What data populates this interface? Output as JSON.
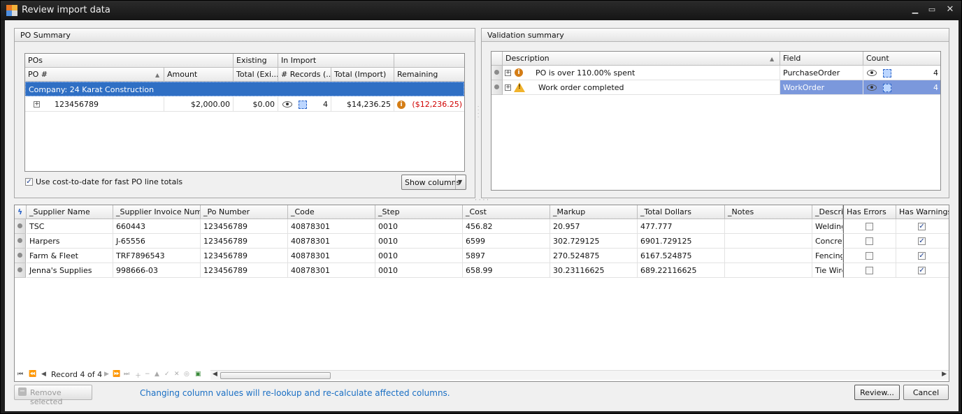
{
  "window": {
    "title": "Review import data"
  },
  "po_summary": {
    "title": "PO Summary",
    "bands": {
      "pos": "POs",
      "existing": "Existing",
      "in_import": "In Import"
    },
    "columns": [
      "PO #",
      "Amount",
      "Total (Exi...",
      "# Records (...",
      "Total (Import)",
      "Remaining"
    ],
    "group_label": "Company: 24 Karat Construction",
    "row": {
      "po": "123456789",
      "amount": "$2,000.00",
      "total_existing": "$0.00",
      "records": "4",
      "total_import": "$14,236.25",
      "remaining": "($12,236.25)"
    },
    "option_label": "Use cost-to-date for fast PO line totals",
    "show_columns_label": "Show columns"
  },
  "validation": {
    "title": "Validation summary",
    "columns": [
      "Description",
      "Field",
      "Count"
    ],
    "rows": [
      {
        "description": "PO is over 110.00% spent",
        "field": "PurchaseOrder",
        "count": "4"
      },
      {
        "description": "Work order completed",
        "field": "WorkOrder",
        "count": "4"
      }
    ]
  },
  "records": {
    "columns": [
      "_Supplier Name",
      "_Supplier Invoice Num...",
      "_Po Number",
      "_Code",
      "_Step",
      "_Cost",
      "_Markup",
      "_Total Dollars",
      "_Notes",
      "_Descrip",
      "Has Errors",
      "Has Warnings"
    ],
    "rows": [
      [
        "TSC",
        "660443",
        "123456789",
        "40878301",
        "0010",
        "456.82",
        "20.957",
        "477.777",
        "",
        "Welding"
      ],
      [
        "Harpers",
        "J-65556",
        "123456789",
        "40878301",
        "0010",
        "6599",
        "302.729125",
        "6901.729125",
        "",
        "Concret"
      ],
      [
        "Farm & Fleet",
        "TRF7896543",
        "123456789",
        "40878301",
        "0010",
        "5897",
        "270.524875",
        "6167.524875",
        "",
        "Fencing"
      ],
      [
        "Jenna's Supplies",
        "998666-03",
        "123456789",
        "40878301",
        "0010",
        "658.99",
        "30.23116625",
        "689.22116625",
        "",
        "Tie Wire"
      ]
    ],
    "navigator_text": "Record 4 of 4"
  },
  "footer": {
    "remove_label": "Remove selected",
    "info_text": "Changing column values will re-lookup and re-calculate affected columns.",
    "review_label": "Review...",
    "cancel_label": "Cancel"
  },
  "colors": {
    "accent": "#2f6fc4",
    "info": "#1a6fc4",
    "negative": "#d00000"
  }
}
